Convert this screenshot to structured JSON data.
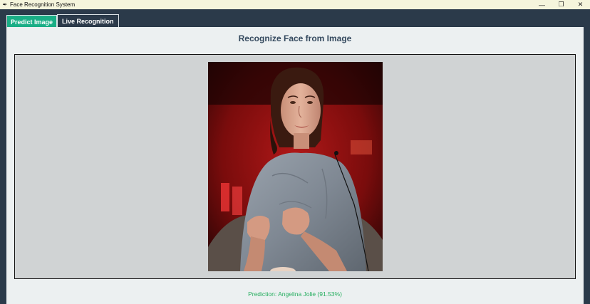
{
  "window": {
    "title": "Face Recognition System",
    "controls": {
      "minimize": "—",
      "restore": "❐",
      "close": "✕"
    }
  },
  "tabs": [
    {
      "label": "Predict Image",
      "active": true
    },
    {
      "label": "Live Recognition",
      "active": false
    }
  ],
  "main": {
    "heading": "Recognize Face from Image",
    "prediction_text": "Prediction: Angelina Jolie (91.53%)"
  },
  "colors": {
    "titlebar_bg": "#f5f5dc",
    "window_bg": "#2b3a4a",
    "panel_bg": "#ecf0f1",
    "active_tab": "#1aae86",
    "heading": "#34495e",
    "prediction": "#27ae60",
    "image_frame_bg": "#d0d3d4"
  }
}
